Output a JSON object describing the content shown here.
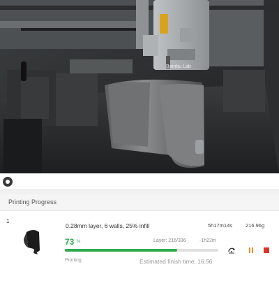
{
  "camera": {
    "brand_label": "Bambu Lab",
    "lens_icon": "record-dot-icon"
  },
  "progress": {
    "header": "Printing Progress",
    "plate_number": "1",
    "settings": "0.28mm layer, 6 walls, 25% infill",
    "print_time": "5h17m14s",
    "filament_weight": "216.96g",
    "percent": "73",
    "percent_sign": "%",
    "percent_value": 0.73,
    "layer": "Layer: 216/336",
    "remaining": "-1h22m",
    "status": "Printing",
    "finish_time": "Estimated finish time: 16:56",
    "controls": [
      "speed-icon",
      "pause-icon",
      "stop-icon"
    ],
    "colors": {
      "accent": "#2eaa4f",
      "pause": "#f08c1e",
      "stop": "#d9352a"
    }
  }
}
